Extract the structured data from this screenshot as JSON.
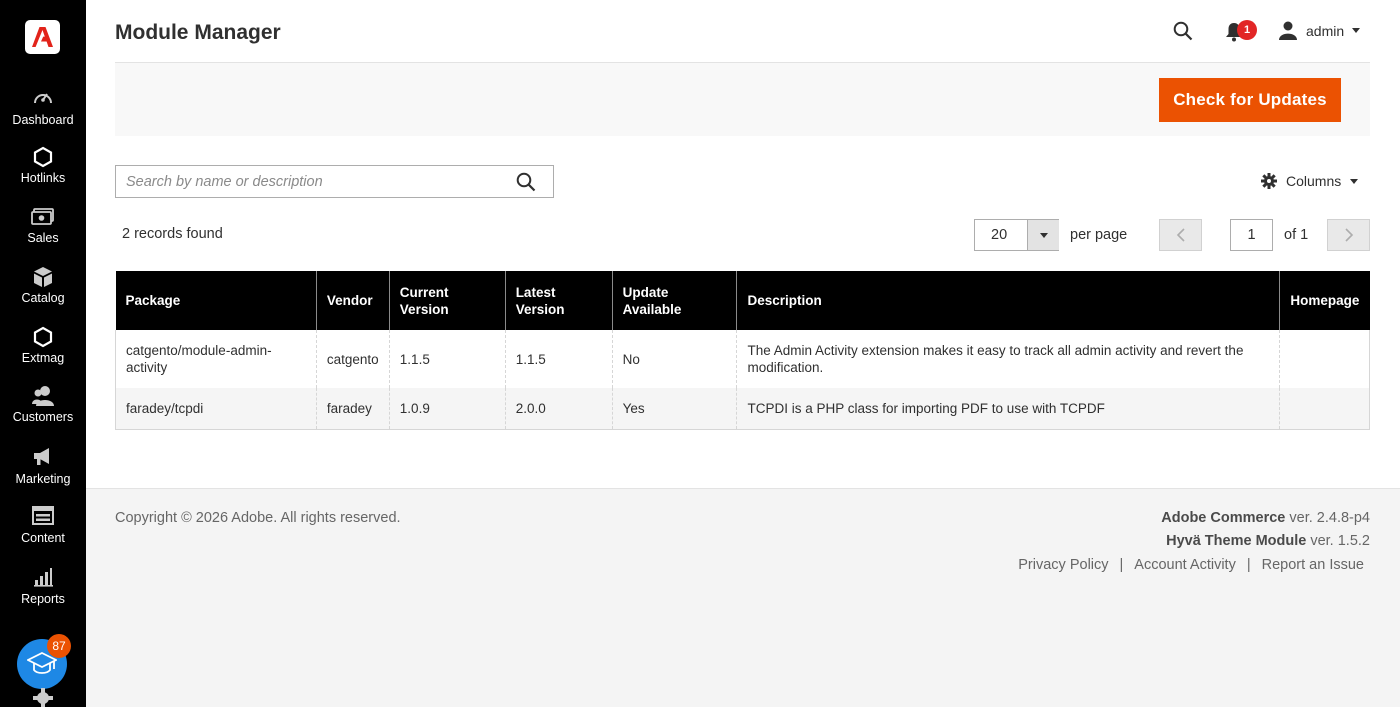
{
  "sidebar": {
    "items": [
      {
        "label": "Dashboard",
        "icon": "dashboard-icon"
      },
      {
        "label": "Hotlinks",
        "icon": "hexagon-icon"
      },
      {
        "label": "Sales",
        "icon": "money-icon"
      },
      {
        "label": "Catalog",
        "icon": "box-icon"
      },
      {
        "label": "Extmag",
        "icon": "hexagon-icon"
      },
      {
        "label": "Customers",
        "icon": "customers-icon"
      },
      {
        "label": "Marketing",
        "icon": "megaphone-icon"
      },
      {
        "label": "Content",
        "icon": "content-icon"
      },
      {
        "label": "Reports",
        "icon": "bar-chart-icon"
      }
    ],
    "help_badge": "87"
  },
  "header": {
    "title": "Module Manager",
    "notification_count": "1",
    "user_name": "admin"
  },
  "actions": {
    "check_updates_label": "Check for Updates"
  },
  "toolbar": {
    "search_placeholder": "Search by name or description",
    "search_value": "",
    "columns_label": "Columns",
    "records_found": "2 records found",
    "per_page_value": "20",
    "per_page_label": "per page",
    "current_page": "1",
    "page_of": "of 1"
  },
  "table": {
    "headers": {
      "package": "Package",
      "vendor": "Vendor",
      "current_version": "Current Version",
      "latest_version": "Latest Version",
      "update_available": "Update Available",
      "description": "Description",
      "homepage": "Homepage"
    },
    "rows": [
      {
        "package": "catgento/module-admin-activity",
        "vendor": "catgento",
        "current_version": "1.1.5",
        "latest_version": "1.1.5",
        "update_available": "No",
        "description": "The Admin Activity extension makes it easy to track all admin activity and revert the modification.",
        "homepage": ""
      },
      {
        "package": "faradey/tcpdi",
        "vendor": "faradey",
        "current_version": "1.0.9",
        "latest_version": "2.0.0",
        "update_available": "Yes",
        "description": "TCPDI is a PHP class for importing PDF to use with TCPDF",
        "homepage": ""
      }
    ]
  },
  "footer": {
    "copyright": "Copyright © 2026 Adobe. All rights reserved.",
    "product_name": "Adobe Commerce",
    "product_version": " ver. 2.4.8-p4",
    "module_name": "Hyvä Theme Module",
    "module_version": " ver. 1.5.2",
    "links": {
      "privacy": "Privacy Policy",
      "sep": "|",
      "activity": "Account Activity",
      "report": "Report an Issue"
    }
  },
  "colors": {
    "accent": "#eb5202",
    "sidebar_bg": "#000000",
    "table_header_bg": "#000000",
    "notification_badge": "#e22626"
  }
}
